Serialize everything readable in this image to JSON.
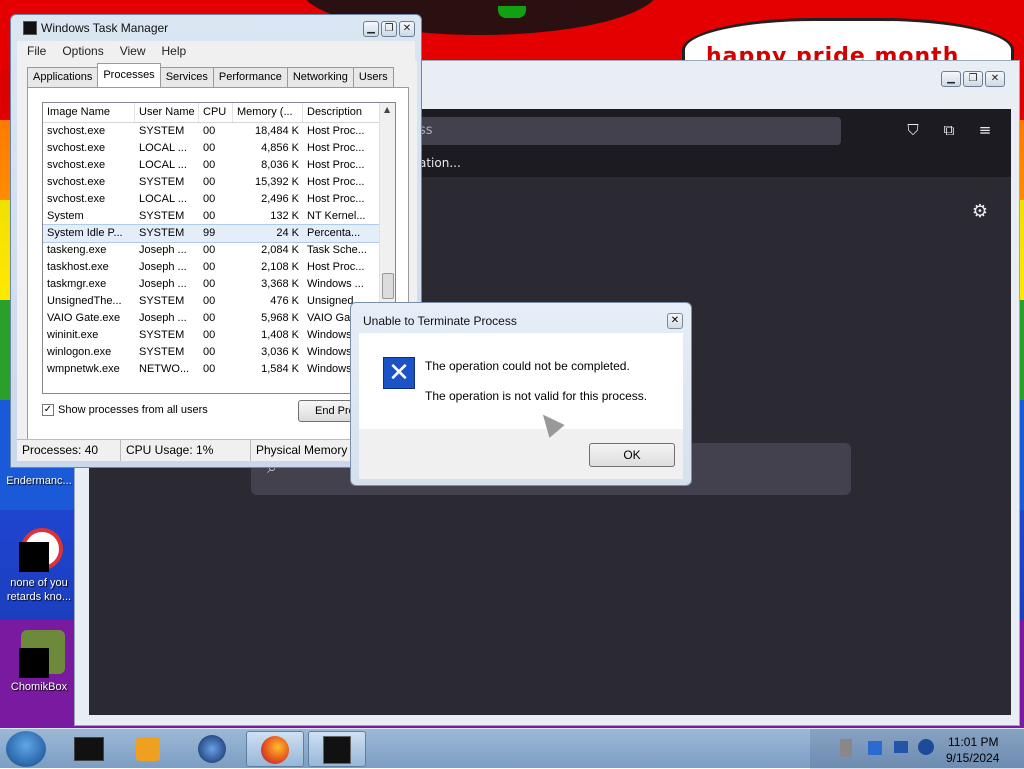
{
  "desktop": {
    "banner_text": "happy pride month",
    "icons": [
      {
        "label": "Endermanc..."
      },
      {
        "label": "none of you retards kno..."
      },
      {
        "label": "ChomikBox"
      }
    ]
  },
  "browser": {
    "url_fragment": "ss",
    "bookmark_fragment": "ation..."
  },
  "taskmgr": {
    "title": "Windows Task Manager",
    "menu": [
      "File",
      "Options",
      "View",
      "Help"
    ],
    "tabs": [
      "Applications",
      "Processes",
      "Services",
      "Performance",
      "Networking",
      "Users"
    ],
    "active_tab": "Processes",
    "columns": [
      "Image Name",
      "User Name",
      "CPU",
      "Memory (...",
      "Description"
    ],
    "rows": [
      [
        "svchost.exe",
        "SYSTEM",
        "00",
        "18,484 K",
        "Host Proc..."
      ],
      [
        "svchost.exe",
        "LOCAL ...",
        "00",
        "4,856 K",
        "Host Proc..."
      ],
      [
        "svchost.exe",
        "LOCAL ...",
        "00",
        "8,036 K",
        "Host Proc..."
      ],
      [
        "svchost.exe",
        "SYSTEM",
        "00",
        "15,392 K",
        "Host Proc..."
      ],
      [
        "svchost.exe",
        "LOCAL ...",
        "00",
        "2,496 K",
        "Host Proc..."
      ],
      [
        "System",
        "SYSTEM",
        "00",
        "132 K",
        "NT Kernel..."
      ],
      [
        "System Idle P...",
        "SYSTEM",
        "99",
        "24 K",
        "Percenta..."
      ],
      [
        "taskeng.exe",
        "Joseph ...",
        "00",
        "2,084 K",
        "Task Sche..."
      ],
      [
        "taskhost.exe",
        "Joseph ...",
        "00",
        "2,108 K",
        "Host Proc..."
      ],
      [
        "taskmgr.exe",
        "Joseph ...",
        "00",
        "3,368 K",
        "Windows ..."
      ],
      [
        "UnsignedThe...",
        "SYSTEM",
        "00",
        "476 K",
        "Unsigned"
      ],
      [
        "VAIO Gate.exe",
        "Joseph ...",
        "00",
        "5,968 K",
        "VAIO Gat"
      ],
      [
        "wininit.exe",
        "SYSTEM",
        "00",
        "1,408 K",
        "Windows"
      ],
      [
        "winlogon.exe",
        "SYSTEM",
        "00",
        "3,036 K",
        "Windows"
      ],
      [
        "wmpnetwk.exe",
        "NETWO...",
        "00",
        "1,584 K",
        "Windows"
      ]
    ],
    "show_all_label": "Show processes from all users",
    "end_process_label": "End Pro",
    "status": {
      "processes": "Processes: 40",
      "cpu": "CPU Usage: 1%",
      "memory": "Physical Memory"
    }
  },
  "dialog": {
    "title": "Unable to Terminate Process",
    "message1": "The operation could not be completed.",
    "message2": "The operation is not valid for this process.",
    "ok_label": "OK"
  },
  "taskbar": {
    "time": "11:01 PM",
    "date": "9/15/2024"
  }
}
